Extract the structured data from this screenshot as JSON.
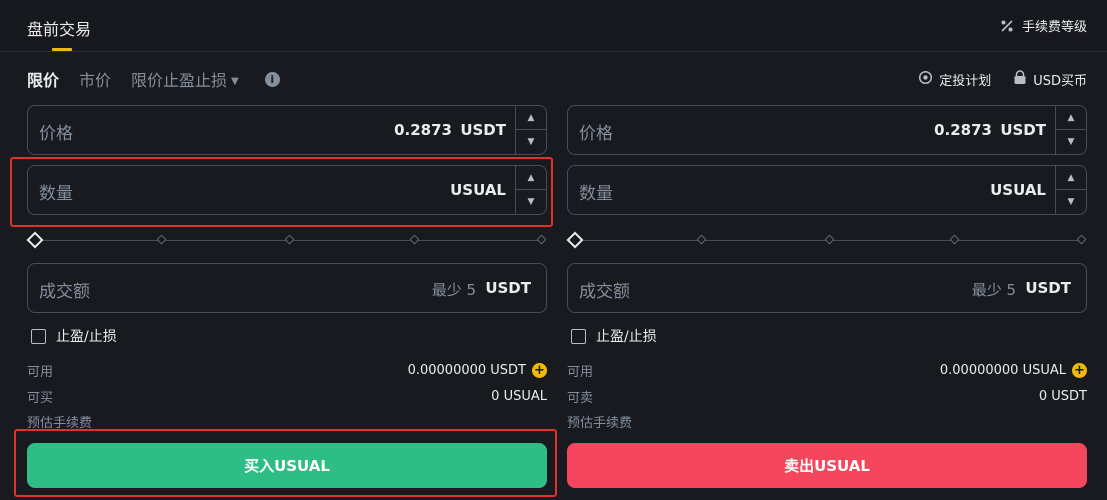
{
  "header": {
    "title": "盘前交易",
    "fee_tier_label": "手续费等级"
  },
  "order_types": {
    "tabs": [
      {
        "label": "限价",
        "active": true
      },
      {
        "label": "市价",
        "active": false
      },
      {
        "label": "限价止盈止损",
        "active": false
      }
    ],
    "info_icon": "i"
  },
  "links": {
    "recurring_plan": "定投计划",
    "usd_buy": "USD买币"
  },
  "buy": {
    "price": {
      "label": "价格",
      "value": "0.2873",
      "unit": "USDT"
    },
    "quantity": {
      "label": "数量",
      "value": "",
      "unit": "USUAL"
    },
    "amount": {
      "label": "成交额",
      "min": "最少 5",
      "unit": "USDT"
    },
    "tpsl_label": "止盈/止损",
    "available": {
      "label": "可用",
      "value": "0.00000000 USDT"
    },
    "max": {
      "label": "可买",
      "value": "0 USUAL"
    },
    "fee": {
      "label": "预估手续费",
      "value": ""
    },
    "button": "买入USUAL"
  },
  "sell": {
    "price": {
      "label": "价格",
      "value": "0.2873",
      "unit": "USDT"
    },
    "quantity": {
      "label": "数量",
      "value": "",
      "unit": "USUAL"
    },
    "amount": {
      "label": "成交额",
      "min": "最少 5",
      "unit": "USDT"
    },
    "tpsl_label": "止盈/止损",
    "available": {
      "label": "可用",
      "value": "0.00000000 USUAL"
    },
    "max": {
      "label": "可卖",
      "value": "0 USDT"
    },
    "fee": {
      "label": "预估手续费",
      "value": ""
    },
    "button": "卖出USUAL"
  },
  "colors": {
    "buy": "#2ebd85",
    "sell": "#f6465d",
    "accent": "#f0b90b",
    "highlight": "#e0322d"
  },
  "icons": [
    "percent-icon",
    "recurring-plan-icon",
    "lock-icon",
    "info-icon",
    "plus-icon",
    "caret-down-icon"
  ]
}
